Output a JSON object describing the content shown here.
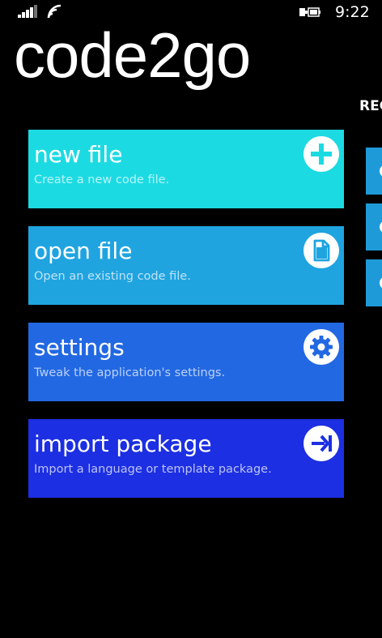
{
  "status_bar": {
    "time": "9:22",
    "icons": [
      "signal-strength-icon",
      "wifi-icon",
      "battery-charging-icon"
    ]
  },
  "app": {
    "title": "code2go"
  },
  "recent_panel": {
    "header": "REC"
  },
  "tiles": [
    {
      "title": "new file",
      "description": "Create a new code file.",
      "icon": "plus-icon",
      "color": "#1cdae2",
      "desc_color": "#b8f4f6"
    },
    {
      "title": "open file",
      "description": "Open an existing code file.",
      "icon": "document-icon",
      "color": "#1fa4e0",
      "desc_color": "#bfe3f6"
    },
    {
      "title": "settings",
      "description": "Tweak the application's settings.",
      "icon": "gear-icon",
      "color": "#2268e2",
      "desc_color": "#bcd1f6"
    },
    {
      "title": "import package",
      "description": "Import a language or template package.",
      "icon": "import-arrow-icon",
      "color": "#1c2fe2",
      "desc_color": "#bdc3f6"
    }
  ]
}
